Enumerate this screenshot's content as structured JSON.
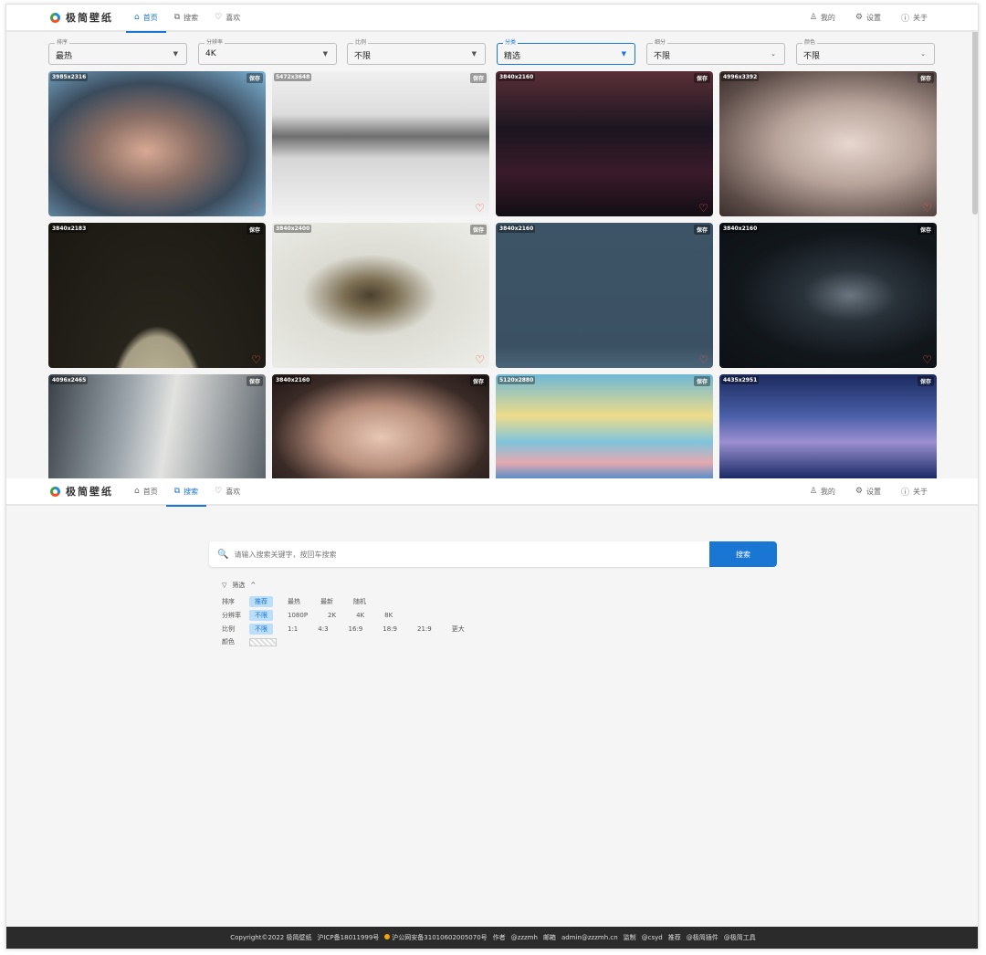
{
  "nav": {
    "logo_text": "极简壁纸",
    "tabs": [
      {
        "icon": "⌂",
        "label": "首页"
      },
      {
        "icon": "⧉",
        "label": "搜索"
      },
      {
        "icon": "♡",
        "label": "喜欢"
      }
    ],
    "right": [
      {
        "icon": "♙",
        "label": "我的"
      },
      {
        "icon": "⚙",
        "label": "设置"
      },
      {
        "icon": "ⓘ",
        "label": "关于"
      }
    ]
  },
  "filters": [
    {
      "label": "排序",
      "value": "最热"
    },
    {
      "label": "分辨率",
      "value": "4K"
    },
    {
      "label": "比例",
      "value": "不限"
    },
    {
      "label": "分类",
      "value": "精选"
    },
    {
      "label": "细分",
      "value": "不限"
    },
    {
      "label": "颜色",
      "value": "不限"
    }
  ],
  "cards": [
    {
      "res": "3985x2316",
      "save": "保存",
      "heart": "♡"
    },
    {
      "res": "5472x3648",
      "save": "保存",
      "heart": "♡"
    },
    {
      "res": "3840x2160",
      "save": "保存",
      "heart": "♡"
    },
    {
      "res": "4996x3392",
      "save": "保存",
      "heart": "♡"
    },
    {
      "res": "3840x2183",
      "save": "保存",
      "heart": "♡"
    },
    {
      "res": "3840x2400",
      "save": "保存",
      "heart": "♡"
    },
    {
      "res": "3840x2160",
      "save": "保存",
      "heart": "♡"
    },
    {
      "res": "3840x2160",
      "save": "保存",
      "heart": "♡"
    },
    {
      "res": "4096x2465",
      "save": "保存",
      "heart": "♡"
    },
    {
      "res": "3840x2160",
      "save": "保存",
      "heart": "♡"
    },
    {
      "res": "5120x2880",
      "save": "保存",
      "heart": "♡"
    },
    {
      "res": "4435x2951",
      "save": "保存",
      "heart": "♡"
    }
  ],
  "search": {
    "icon": "🔍",
    "placeholder": "请输入搜索关键字，按回车搜索",
    "button": "搜索",
    "filter_icon": "▽",
    "filter_label": "筛选",
    "filter_caret": "^"
  },
  "search_filters": {
    "sort": {
      "label": "排序",
      "options": [
        "推荐",
        "最热",
        "最新",
        "随机"
      ]
    },
    "resolution": {
      "label": "分辨率",
      "options": [
        "不限",
        "1080P",
        "2K",
        "4K",
        "8K"
      ]
    },
    "ratio": {
      "label": "比例",
      "options": [
        "不限",
        "1:1",
        "4:3",
        "16:9",
        "18:9",
        "21:9",
        "更大"
      ]
    },
    "color": {
      "label": "颜色"
    }
  },
  "footer": {
    "copyright": "Copyright©2022 极简壁纸",
    "icp": "沪ICP备18011999号",
    "police": "沪公网安备31010602005070号",
    "author_label": "作者",
    "author": "@zzzmh",
    "email_label": "邮箱",
    "email": "admin@zzzmh.cn",
    "monitor": "监制",
    "csyd": "@csyd",
    "recommend": "推荐",
    "plugin": "@极简插件",
    "tools": "@极简工具"
  }
}
